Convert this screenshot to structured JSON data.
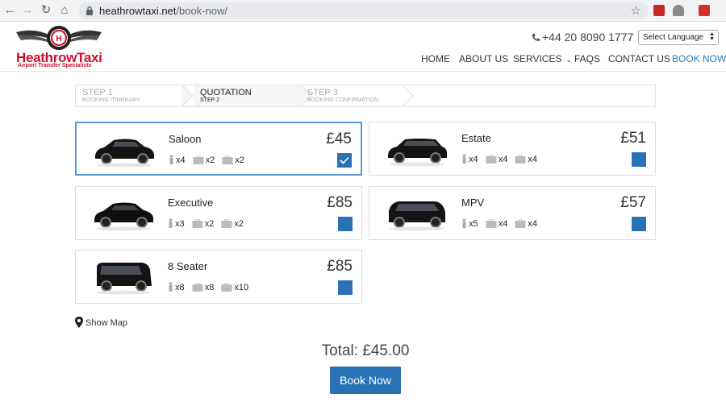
{
  "browser": {
    "url_domain": "heathrowtaxi.net",
    "url_path": "/book-now/"
  },
  "site": {
    "logo_title": "HeathrowTaxi",
    "logo_subtitle": "Airport Transfer Specialists",
    "phone": "+44 20 8090 1777",
    "language_select": "Select Language",
    "nav": [
      {
        "label": "HOME"
      },
      {
        "label": "ABOUT US"
      },
      {
        "label": "SERVICES"
      },
      {
        "label": "FAQS"
      },
      {
        "label": "CONTACT US"
      },
      {
        "label": "BOOK NOW",
        "active": true
      }
    ]
  },
  "steps": [
    {
      "title": "STEP 1",
      "subtitle": "BOOKING ITINERARY"
    },
    {
      "title": "QUOTATION",
      "subtitle": "STEP 2",
      "current": true
    },
    {
      "title": "STEP 3",
      "subtitle": "BOOKING CONFIRMATION"
    }
  ],
  "vehicles": [
    {
      "name": "Saloon",
      "price": "£45",
      "passengers": "x4",
      "large_bags": "x2",
      "small_bags": "x2",
      "selected": true
    },
    {
      "name": "Estate",
      "price": "£51",
      "passengers": "x4",
      "large_bags": "x4",
      "small_bags": "x4",
      "selected": false
    },
    {
      "name": "Executive",
      "price": "£85",
      "passengers": "x3",
      "large_bags": "x2",
      "small_bags": "x2",
      "selected": false
    },
    {
      "name": "MPV",
      "price": "£57",
      "passengers": "x5",
      "large_bags": "x4",
      "small_bags": "x4",
      "selected": false
    },
    {
      "name": "8 Seater",
      "price": "£85",
      "passengers": "x8",
      "large_bags": "x8",
      "small_bags": "x10",
      "selected": false
    }
  ],
  "show_map": "Show Map",
  "total": "Total: £45.00",
  "book_now": "Book Now",
  "colors": {
    "accent": "#2a72b5",
    "brand_red": "#c8102e",
    "nav_active": "#2e7bbf"
  },
  "icons": {
    "passenger": "person-icon",
    "large_bag": "suitcase-icon",
    "small_bag": "bag-icon",
    "map": "map-pin-icon"
  }
}
